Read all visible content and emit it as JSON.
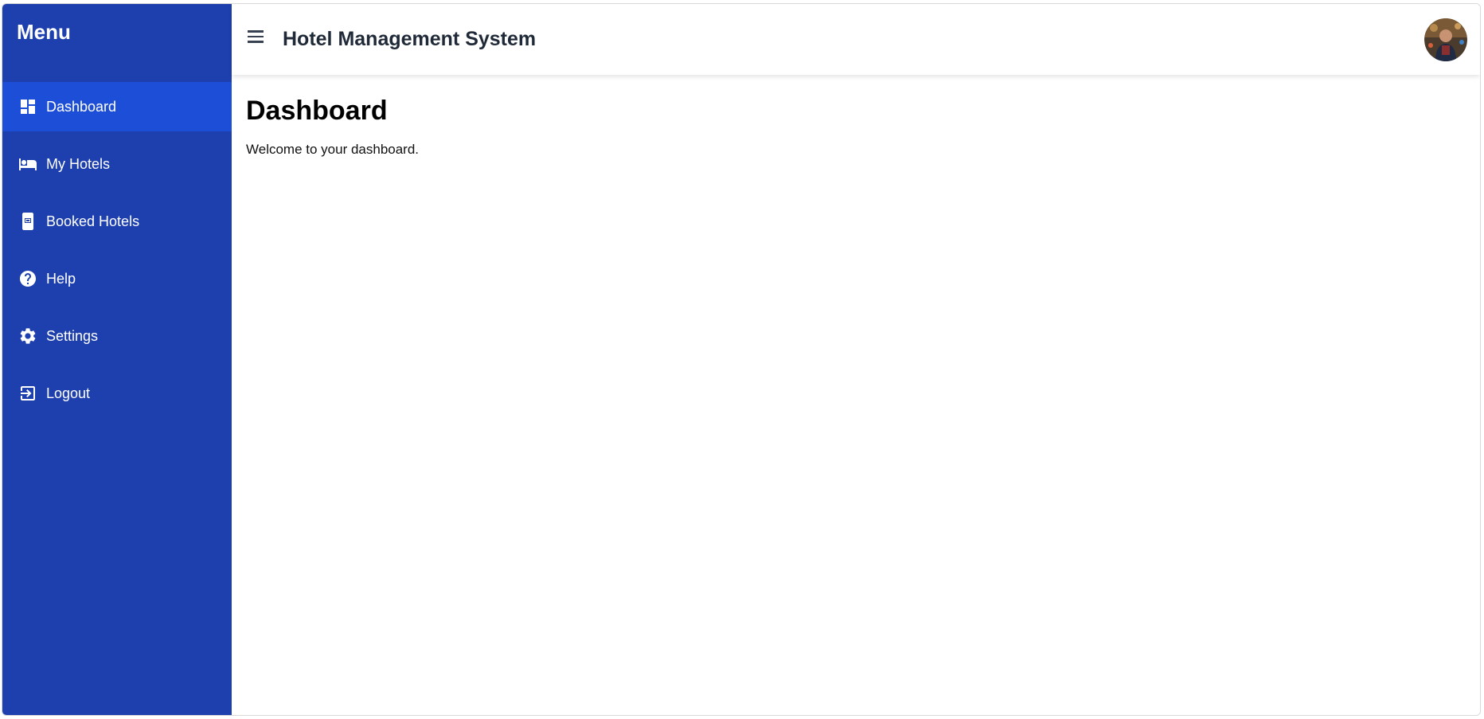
{
  "colors": {
    "sidebar_bg": "#1e40af",
    "sidebar_active_bg": "#1d4ed8",
    "header_bg": "#ffffff",
    "text_dark": "#1f2937"
  },
  "sidebar": {
    "title": "Menu",
    "items": [
      {
        "label": "Dashboard",
        "icon": "dashboard-icon",
        "active": true
      },
      {
        "label": "My Hotels",
        "icon": "bed-icon",
        "active": false
      },
      {
        "label": "Booked Hotels",
        "icon": "booking-icon",
        "active": false
      },
      {
        "label": "Help",
        "icon": "help-icon",
        "active": false
      },
      {
        "label": "Settings",
        "icon": "gear-icon",
        "active": false
      },
      {
        "label": "Logout",
        "icon": "logout-icon",
        "active": false
      }
    ]
  },
  "header": {
    "title": "Hotel Management System",
    "menu_icon": "hamburger-icon",
    "avatar_icon": "user-avatar"
  },
  "main": {
    "title": "Dashboard",
    "welcome_text": "Welcome to your dashboard."
  }
}
